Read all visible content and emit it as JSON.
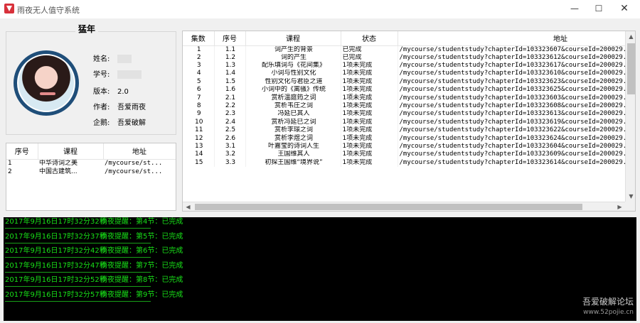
{
  "window": {
    "title": "雨夜无人值守系统",
    "controls": {
      "minimize": "—",
      "maximize": "☐",
      "close": "✕"
    }
  },
  "profile": {
    "header": "猛年",
    "name_label": "姓名:",
    "id_label": "学号:",
    "version_label": "版本:",
    "version": "2.0",
    "author_label": "作者:",
    "author": "吾爱雨夜",
    "penguin_label": "企鹅:",
    "penguin": "吾爱破解"
  },
  "course_list": {
    "columns": [
      "序号",
      "课程",
      "地址"
    ],
    "rows": [
      [
        "1",
        "中华诗词之美",
        "/mycourse/st..."
      ],
      [
        "2",
        "中国古建筑...",
        "/mycourse/st..."
      ]
    ]
  },
  "chapter_grid": {
    "columns": [
      "集数",
      "序号",
      "课程",
      "状态",
      "地址"
    ],
    "rows": [
      [
        "1",
        "1.1",
        "词产生的背景",
        "已完成",
        "/mycourse/studentstudy?chapterId=103323607&courseId=200029..."
      ],
      [
        "2",
        "1.2",
        "词的产生",
        "已完成",
        "/mycourse/studentstudy?chapterId=103323612&courseId=200029..."
      ],
      [
        "3",
        "1.3",
        "配乐填词与《花间集》",
        "1项未完成",
        "/mycourse/studentstudy?chapterId=103323617&courseId=200029..."
      ],
      [
        "4",
        "1.4",
        "小词与性别文化",
        "1项未完成",
        "/mycourse/studentstudy?chapterId=103323610&courseId=200029..."
      ],
      [
        "5",
        "1.5",
        "性别文化与君臣之道",
        "1项未完成",
        "/mycourse/studentstudy?chapterId=103323623&courseId=200029..."
      ],
      [
        "6",
        "1.6",
        "小词中的《离骚》传统",
        "1项未完成",
        "/mycourse/studentstudy?chapterId=103323625&courseId=200029..."
      ],
      [
        "7",
        "2.1",
        "赏析温庭筠之词",
        "1项未完成",
        "/mycourse/studentstudy?chapterId=103323603&courseId=200029..."
      ],
      [
        "8",
        "2.2",
        "赏析韦庄之词",
        "1项未完成",
        "/mycourse/studentstudy?chapterId=103323608&courseId=200029..."
      ],
      [
        "9",
        "2.3",
        "冯延巳其人",
        "1项未完成",
        "/mycourse/studentstudy?chapterId=103323613&courseId=200029..."
      ],
      [
        "10",
        "2.4",
        "赏析冯延巳之词",
        "1项未完成",
        "/mycourse/studentstudy?chapterId=103323619&courseId=200029..."
      ],
      [
        "11",
        "2.5",
        "赏析李璟之词",
        "1项未完成",
        "/mycourse/studentstudy?chapterId=103323622&courseId=200029..."
      ],
      [
        "12",
        "2.6",
        "赏析李煜之词",
        "1项未完成",
        "/mycourse/studentstudy?chapterId=103323624&courseId=200029..."
      ],
      [
        "13",
        "3.1",
        "叶嘉莹的诗词人生",
        "1项未完成",
        "/mycourse/studentstudy?chapterId=103323604&courseId=200029..."
      ],
      [
        "14",
        "3.2",
        "王国维其人",
        "1项未完成",
        "/mycourse/studentstudy?chapterId=103323609&courseId=200029..."
      ],
      [
        "15",
        "3.3",
        "初探王国维“境界说”",
        "1项未完成",
        "/mycourse/studentstudy?chapterId=103323614&courseId=200029..."
      ]
    ]
  },
  "log": [
    {
      "time": "2017年9月16日17时32分32秒",
      "message": "雨夜提醒：第4节：已完成"
    },
    {
      "time": "2017年9月16日17时32分37秒",
      "message": "雨夜提醒：第5节：已完成"
    },
    {
      "time": "2017年9月16日17时32分42秒",
      "message": "雨夜提醒：第6节：已完成"
    },
    {
      "time": "2017年9月16日17时32分47秒",
      "message": "雨夜提醒：第7节：已完成"
    },
    {
      "time": "2017年9月16日17时32分52秒",
      "message": "雨夜提醒：第8节：已完成"
    },
    {
      "time": "2017年9月16日17时32分57秒",
      "message": "雨夜提醒：第9节：已完成"
    }
  ],
  "watermark": {
    "main": "吾爱破解论坛",
    "url": "www.52pojie.cn"
  },
  "colors": {
    "log_text": "#18e018",
    "log_bg": "#000000",
    "avatar_ring": "#1f4e79"
  }
}
